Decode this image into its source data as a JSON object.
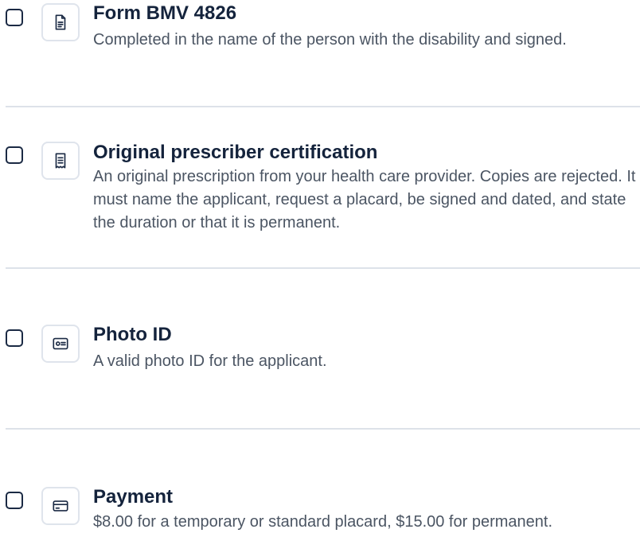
{
  "items": [
    {
      "title": "Form BMV 4826",
      "description": "Completed in the name of the person with the disability and signed.",
      "icon": "document-icon",
      "checked": false
    },
    {
      "title": "Original prescriber certification",
      "description": "An original prescription from your health care provider. Copies are rejected. It must name the applicant, request a placard, be signed and dated, and state the duration or that it is permanent.",
      "icon": "receipt-icon",
      "checked": false
    },
    {
      "title": "Photo ID",
      "description": "A valid photo ID for the applicant.",
      "icon": "id-card-icon",
      "checked": false
    },
    {
      "title": "Payment",
      "description": "$8.00 for a temporary or standard placard, $15.00 for permanent.",
      "icon": "credit-card-icon",
      "checked": false
    }
  ],
  "colors": {
    "title": "#14233c",
    "description": "#4b5563",
    "border": "#dfe4ec",
    "icon_stroke": "#1b2a44"
  }
}
